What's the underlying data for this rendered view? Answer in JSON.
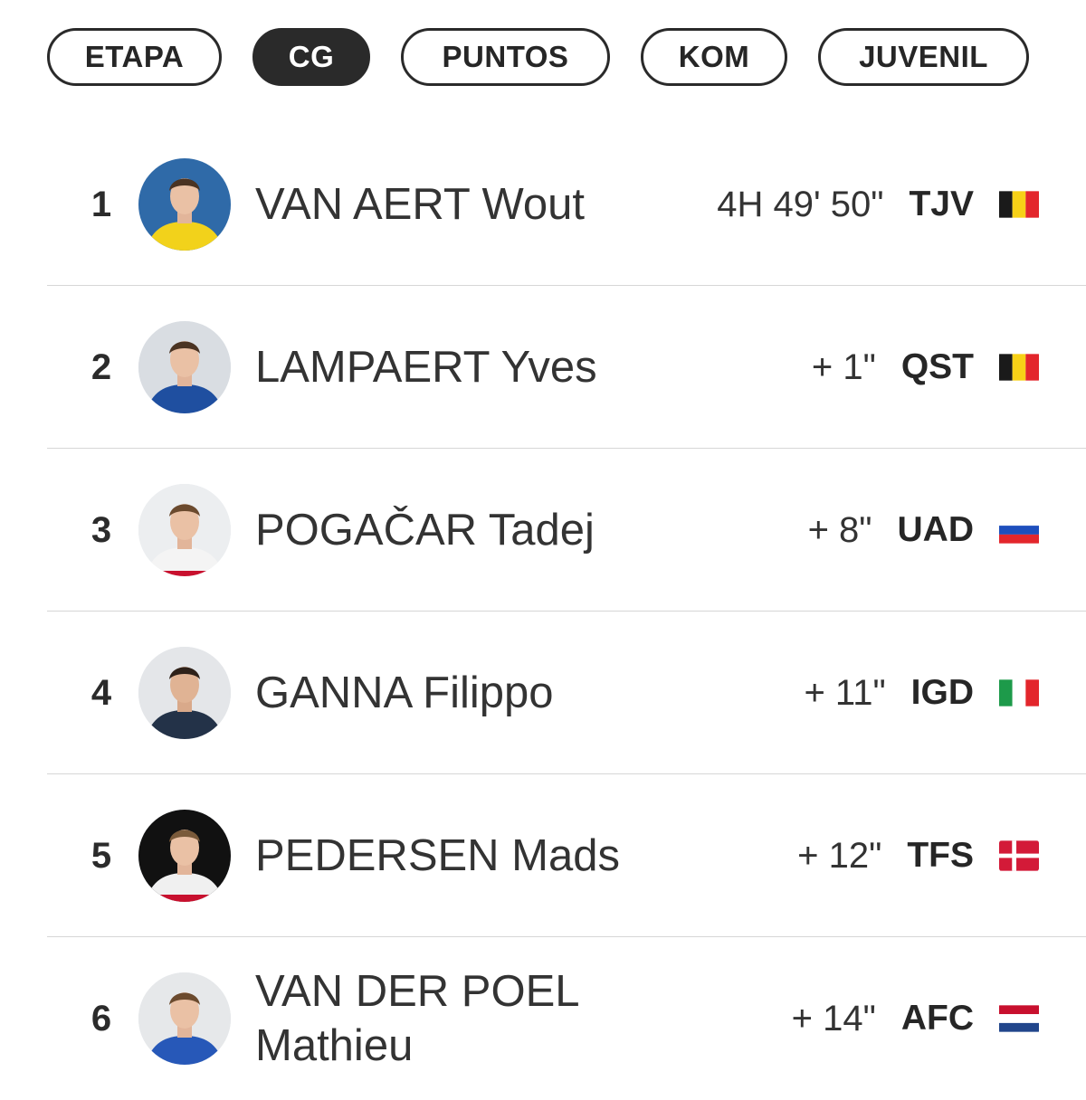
{
  "tabs": [
    "ETAPA",
    "CG",
    "PUNTOS",
    "KOM",
    "JUVENIL"
  ],
  "active_tab": "CG",
  "standings": [
    {
      "position": "1",
      "name": "VAN AERT Wout",
      "time": "4H 49' 50\"",
      "team": "TJV",
      "flag": "belgium-flag",
      "jersey_color": "#f2d21b"
    },
    {
      "position": "2",
      "name": "LAMPAERT Yves",
      "time": "+ 1\"",
      "team": "QST",
      "flag": "belgium-flag",
      "jersey_color": "#1f4fa0"
    },
    {
      "position": "3",
      "name": "POGAČAR Tadej",
      "time": "+ 8\"",
      "team": "UAD",
      "flag": "slovenia-flag",
      "jersey_color": "#f4f4f4"
    },
    {
      "position": "4",
      "name": "GANNA Filippo",
      "time": "+ 11\"",
      "team": "IGD",
      "flag": "italy-flag",
      "jersey_color": "#233248"
    },
    {
      "position": "5",
      "name": "PEDERSEN Mads",
      "time": "+ 12\"",
      "team": "TFS",
      "flag": "denmark-flag",
      "jersey_color": "#f0f0f0"
    },
    {
      "position": "6",
      "name": "VAN DER POEL Mathieu",
      "time": "+ 14\"",
      "team": "AFC",
      "flag": "netherlands-flag",
      "jersey_color": "#2758b8"
    }
  ],
  "colors": {
    "text": "#2b2b2b",
    "tab_border": "#2a2a2a",
    "active_tab_bg": "#2a2a2a",
    "divider": "#d6d6d6"
  }
}
